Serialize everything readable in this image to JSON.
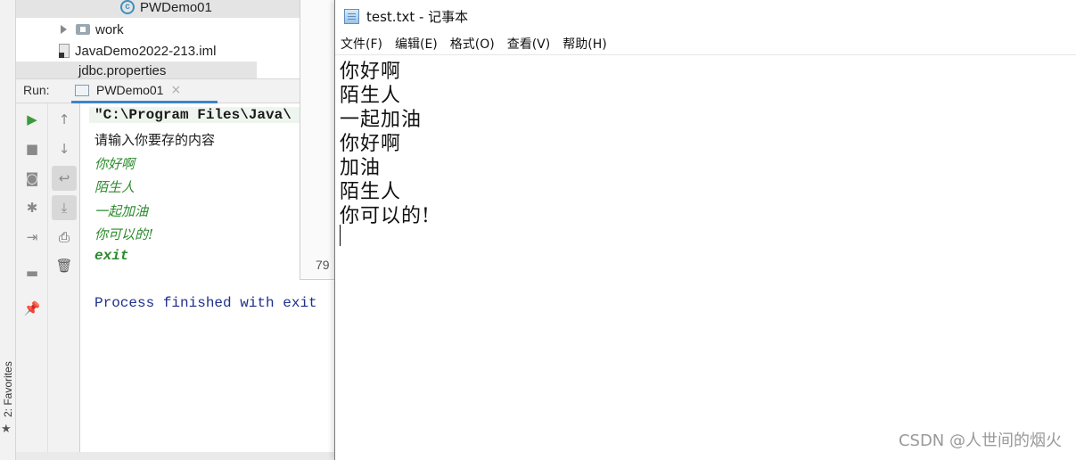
{
  "ide": {
    "favorites_label": "2: Favorites",
    "project_tree": {
      "selected_item": "PWDemo01",
      "folder_item": "work",
      "file_item": "JavaDemo2022-213.iml",
      "partial_item": "jdbc.properties"
    },
    "run_panel": {
      "label": "Run:",
      "tab_label": "PWDemo01",
      "close_glyph": "×"
    },
    "console": {
      "command_line": "\"C:\\Program Files\\Java\\",
      "prompt": "请输入你要存的内容",
      "inputs": [
        "你好啊",
        "陌生人",
        "一起加油",
        "你可以的!"
      ],
      "exit_input": "exit",
      "finish_message": "Process finished with exit"
    },
    "gap_number": "79"
  },
  "notepad": {
    "title": "test.txt - 记事本",
    "menu": [
      "文件(F)",
      "编辑(E)",
      "格式(O)",
      "查看(V)",
      "帮助(H)"
    ],
    "lines": [
      "你好啊",
      "陌生人",
      "一起加油",
      "你好啊",
      "加油",
      "陌生人",
      "你可以的!"
    ]
  },
  "watermark": "CSDN @人世间的烟火"
}
